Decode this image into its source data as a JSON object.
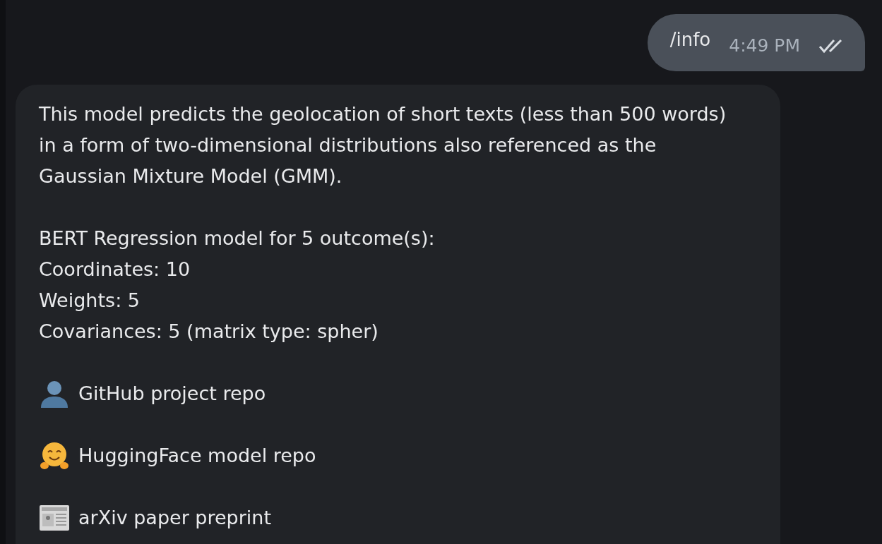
{
  "outgoing_message": {
    "text": "/info",
    "time": "4:49 PM",
    "read": true
  },
  "incoming_message": {
    "paragraphs": [
      "This model predicts the geolocation of short texts (less than 500 words) in a form of two-dimensional distributions also referenced as the Gaussian Mixture Model (GMM).",
      "BERT Regression model for 5 outcome(s):\nCoordinates: 10\nWeights: 5\nCovariances: 5 (matrix type: spher)"
    ],
    "links": [
      {
        "kind": "person",
        "label": "GitHub project repo"
      },
      {
        "kind": "hugging",
        "label": "HuggingFace model repo"
      },
      {
        "kind": "newspaper",
        "label": "arXiv paper preprint"
      }
    ]
  }
}
